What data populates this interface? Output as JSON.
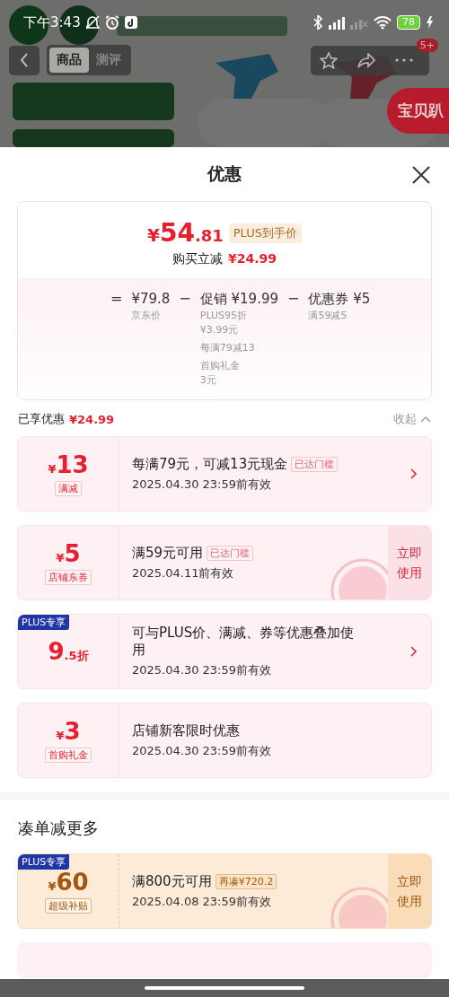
{
  "status_bar": {
    "time": "下午3:43",
    "battery": "78"
  },
  "product_nav": {
    "tabs": [
      {
        "label": "商品",
        "selected": true
      },
      {
        "label": "测评",
        "selected": false
      }
    ],
    "badge": "5+",
    "float_tab": "宝贝趴"
  },
  "sheet": {
    "title": "优惠"
  },
  "summary": {
    "price": {
      "symbol": "¥",
      "integer": "54",
      "decimal": ".81"
    },
    "price_tag": "PLUS到手价",
    "saving_label": "购买立减",
    "saving": "¥24.99",
    "breakdown": [
      {
        "kind": "op",
        "text": "="
      },
      {
        "kind": "term",
        "amount": "¥79.8",
        "notes": [
          [
            "京东价"
          ]
        ]
      },
      {
        "kind": "op",
        "text": "−"
      },
      {
        "kind": "term",
        "amount": "促销 ¥19.99",
        "notes": [
          [
            "PLUS95折",
            "¥3.99元"
          ],
          [
            "每满79减13"
          ],
          [
            "首购礼金",
            "3元"
          ]
        ]
      },
      {
        "kind": "op",
        "text": "−"
      },
      {
        "kind": "term",
        "amount": "优惠券 ¥5",
        "notes": [
          [
            "满59减5"
          ]
        ]
      }
    ]
  },
  "enjoyed": {
    "label": "已享优惠",
    "amount": "¥24.99",
    "toggle": "收起",
    "expanded": true
  },
  "coupons": [
    {
      "kind": "arrow",
      "color": "#e8202e",
      "prefix": "¥",
      "big": "13",
      "tag": "满减",
      "title": "每满79元，可减13元现金",
      "status": "已达门槛",
      "validity": "2025.04.30 23:59前有效",
      "claimed": false
    },
    {
      "kind": "ticket",
      "color": "#e8202e",
      "prefix": "¥",
      "big": "5",
      "tag": "店铺东券",
      "title": "满59元可用",
      "status": "已达门槛",
      "validity": "2025.04.11前有效",
      "action": "立即使用",
      "claimed": true
    },
    {
      "kind": "arrow",
      "color": "#e8202e",
      "badge": "PLUS专享",
      "big": "9",
      "suffix": ".5折",
      "title": "可与PLUS价、满减、券等优惠叠加使用",
      "validity": "2025.04.30 23:59前有效",
      "claimed": false
    },
    {
      "kind": "plain",
      "color": "#e8202e",
      "prefix": "¥",
      "big": "3",
      "tag": "首购礼金",
      "title": "店铺新客限时优惠",
      "validity": "2025.04.30 23:59前有效",
      "claimed": false
    }
  ],
  "more": {
    "title": "凑单减更多",
    "coupons": [
      {
        "kind": "ticket",
        "color": "#a4550f",
        "badge": "PLUS专享",
        "prefix": "¥",
        "big": "60",
        "tag": "超级补贴",
        "title": "满800元可用",
        "status": "再凑¥720.2",
        "validity": "2025.04.08 23:59前有效",
        "action": "立即使用",
        "claimed": true
      }
    ]
  }
}
